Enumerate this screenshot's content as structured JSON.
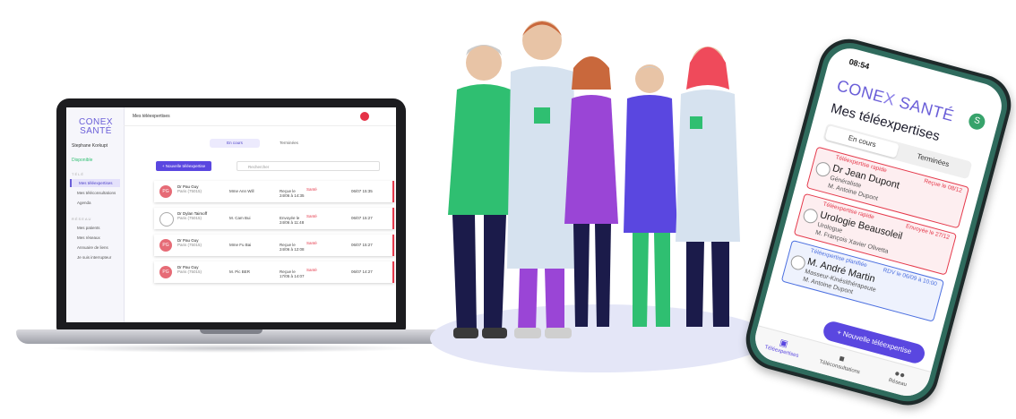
{
  "laptop": {
    "logo_line1": "CONEX",
    "logo_line2": "SANTÉ",
    "user_name": "Stephane Korkupt",
    "availability": "Disponible",
    "sidebar": {
      "section_tele": "TÉLÉ",
      "items": [
        "Mes téléexpertises",
        "Mes téléconsultations",
        "Agenda"
      ],
      "section_other": "RÉSEAU",
      "others": [
        "Mes patients",
        "Mes réseaux",
        "Annuaire de liens",
        "Je suis interrupteur"
      ]
    },
    "page_title": "Mes téléexpertises",
    "tabs": [
      "En cours",
      "Terminées"
    ],
    "new_button": "+ Nouvelle téléexpertise",
    "search_placeholder": "Rechercher",
    "cards": [
      {
        "initials": "PG",
        "name": "Dr Pau Guy",
        "place": "Paris (75015)",
        "patient": "Mme Ann Will",
        "status_label": "Reçue le",
        "status_date": "24/06 à 14:35",
        "tag": "Santé",
        "deadline": "06/07 15:35",
        "color": "#e66b76"
      },
      {
        "initials": "",
        "name": "Dr Dylan Taimoff",
        "place": "Paris (75015)",
        "patient": "M. Cam Bui",
        "status_label": "Envoyée le",
        "status_date": "24/06 à 11:48",
        "tag": "Santé",
        "deadline": "06/07 15:27",
        "color": "#ffffff"
      },
      {
        "initials": "PG",
        "name": "Dr Pau Guy",
        "place": "Paris (75015)",
        "patient": "Mme Fu Bai",
        "status_label": "Reçue le",
        "status_date": "24/06 à 12:08",
        "tag": "Santé",
        "deadline": "06/07 15:27",
        "color": "#e66b76"
      },
      {
        "initials": "PG",
        "name": "Dr Pau Guy",
        "place": "Paris (75015)",
        "patient": "M. Pic BER",
        "status_label": "Reçue le",
        "status_date": "17/05 à 14:07",
        "tag": "Santé",
        "deadline": "06/07 14:27",
        "color": "#e66b76"
      }
    ]
  },
  "phone": {
    "time": "08:54",
    "logo_a": "CONE",
    "logo_b": "X",
    "logo_c": " SANTÉ",
    "avatar": "S",
    "title": "Mes téléexpertises",
    "tab_on": "En cours",
    "tab_off": "Terminées",
    "cards": [
      {
        "tag": "Téléexpertise rapide",
        "date": "Reçue le 08/12",
        "doctor": "Dr Jean Dupont",
        "specialty": "Généraliste",
        "patient": "M. Antoine Dupont",
        "color": "#e5394b",
        "bg": "#fdeef0"
      },
      {
        "tag": "Téléexpertise rapide",
        "date": "Envoyée le 27/12",
        "doctor": "Urologie Beausoleil",
        "specialty": "Urologue",
        "patient": "M. François Xavier Olivetta",
        "color": "#e5394b",
        "bg": "#fdeef0"
      },
      {
        "tag": "Téléexpertise planifiée",
        "date": "RDV le 06/09 à 10:00",
        "doctor": "M. André Martin",
        "specialty": "Masseur-Kinésithérapeute",
        "patient": "M. Antoine Dupont",
        "color": "#4b6fe0",
        "bg": "#eef2fd"
      }
    ],
    "fab": "+ Nouvelle téléexpertise",
    "nav": [
      "Téléexpertises",
      "Téléconsultations",
      "Réseau"
    ]
  },
  "colors": {
    "brand": "#6a5ed8",
    "primary_button": "#5a47e0",
    "urgent": "#e5394b",
    "planned": "#4b6fe0",
    "figure_green": "#2fbf71",
    "figure_purple": "#9a45d6",
    "figure_coat": "#d6e2ef",
    "figure_pants": "#1b1b4a"
  }
}
